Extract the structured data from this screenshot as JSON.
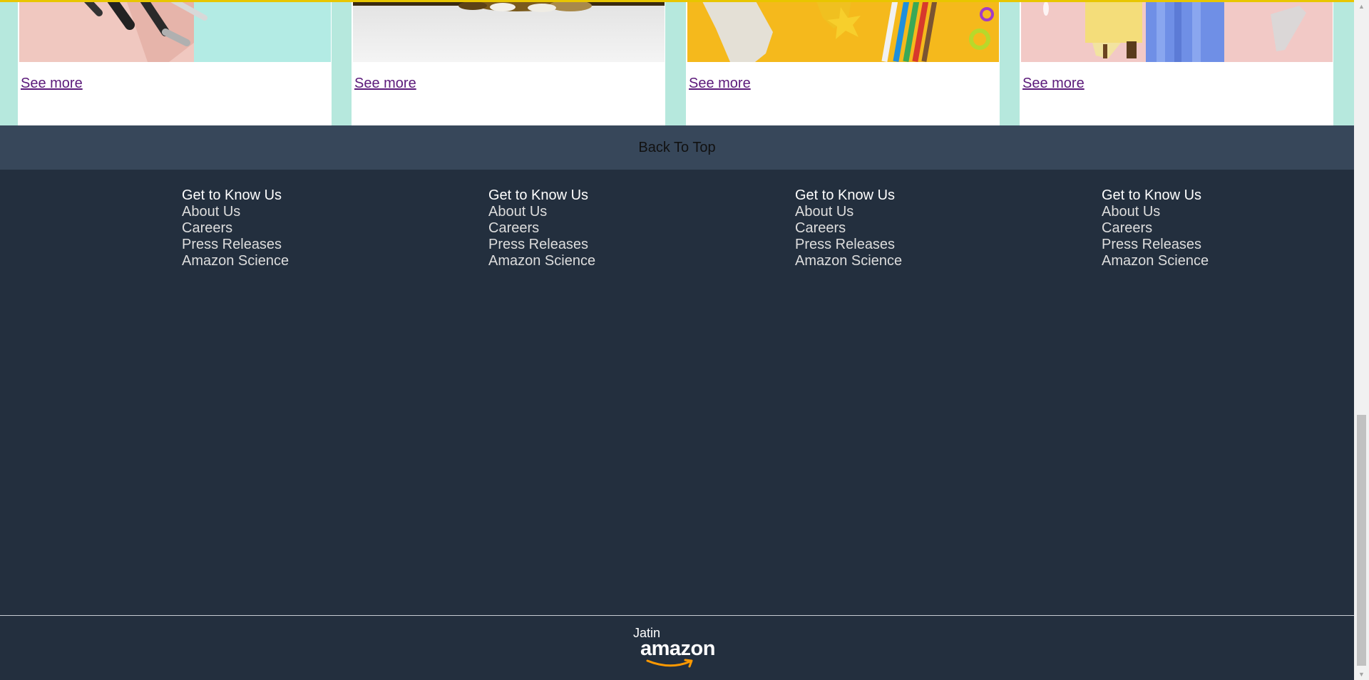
{
  "cards": [
    {
      "see_more": "See more",
      "image": "makeup-brushes-on-pink-and-teal"
    },
    {
      "see_more": "See more",
      "image": "pet-on-grey-floor"
    },
    {
      "see_more": "See more",
      "image": "stationery-on-yellow"
    },
    {
      "see_more": "See more",
      "image": "fashion-on-pink"
    }
  ],
  "back_to_top": "Back To Top",
  "footer": {
    "columns": [
      {
        "heading": "Get to Know Us",
        "links": [
          "About Us",
          "Careers",
          "Press Releases",
          "Amazon Science"
        ]
      },
      {
        "heading": "Get to Know Us",
        "links": [
          "About Us",
          "Careers",
          "Press Releases",
          "Amazon Science"
        ]
      },
      {
        "heading": "Get to Know Us",
        "links": [
          "About Us",
          "Careers",
          "Press Releases",
          "Amazon Science"
        ]
      },
      {
        "heading": "Get to Know Us",
        "links": [
          "About Us",
          "Careers",
          "Press Releases",
          "Amazon Science"
        ]
      }
    ]
  },
  "logo": {
    "owner": "Jatin",
    "brand": "amazon"
  },
  "colors": {
    "back_to_top_bg": "#37475a",
    "footer_bg": "#232f3e",
    "card_area_bg": "#b6e8dd",
    "link_visited": "#5b1a7a",
    "smile": "#ff9900"
  }
}
